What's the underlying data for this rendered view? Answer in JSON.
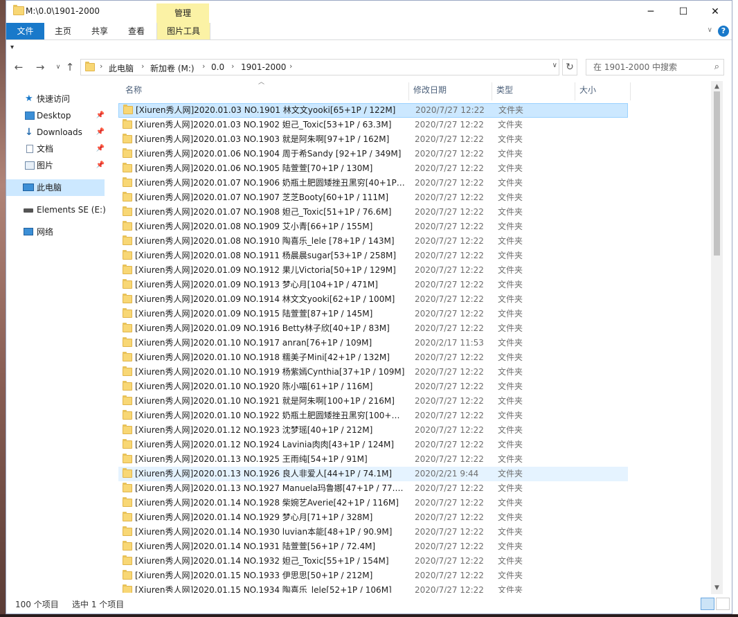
{
  "window": {
    "title": "M:\\0.0\\1901-2000",
    "context_tab": "管理",
    "controls": {
      "minimize": "─",
      "maximize": "☐",
      "close": "✕"
    }
  },
  "ribbon": {
    "tabs": [
      "文件",
      "主页",
      "共享",
      "查看",
      "图片工具"
    ],
    "expand": "∨",
    "help": "?"
  },
  "quick_access": "▾",
  "address": {
    "crumbs": [
      "此电脑",
      "新加卷 (M:)",
      "0.0",
      "1901-2000"
    ],
    "separator": "›",
    "dropdown": "∨",
    "refresh": "↻"
  },
  "search": {
    "placeholder": "在 1901-2000 中搜索",
    "icon": "⌕"
  },
  "sidebar": {
    "items": [
      {
        "label": "快速访问",
        "icon": "star-icon"
      },
      {
        "label": "Desktop",
        "icon": "desktop-icon",
        "pinned": true
      },
      {
        "label": "Downloads",
        "icon": "download-icon",
        "pinned": true
      },
      {
        "label": "文档",
        "icon": "document-icon",
        "pinned": true
      },
      {
        "label": "图片",
        "icon": "pictures-icon",
        "pinned": true
      },
      {
        "label": "此电脑",
        "icon": "computer-icon",
        "selected": true
      },
      {
        "label": "Elements SE (E:)",
        "icon": "drive-icon"
      },
      {
        "label": "网络",
        "icon": "network-icon"
      }
    ],
    "pin_glyph": "📌"
  },
  "columns": {
    "name": "名称",
    "date": "修改日期",
    "type": "类型",
    "size": "大小",
    "sort_glyph": "︿"
  },
  "files": [
    {
      "name": "[Xiuren秀人网]2020.01.03 NO.1901 林文文yooki[65+1P / 122M]",
      "date": "2020/7/27 12:22",
      "type": "文件夹",
      "state": "selected"
    },
    {
      "name": "[Xiuren秀人网]2020.01.03 NO.1902 妲己_Toxic[53+1P / 63.3M]",
      "date": "2020/7/27 12:22",
      "type": "文件夹"
    },
    {
      "name": "[Xiuren秀人网]2020.01.03 NO.1903 就是阿朱啊[97+1P / 162M]",
      "date": "2020/7/27 12:22",
      "type": "文件夹"
    },
    {
      "name": "[Xiuren秀人网]2020.01.06 NO.1904 周于希Sandy [92+1P / 349M]",
      "date": "2020/7/27 12:22",
      "type": "文件夹"
    },
    {
      "name": "[Xiuren秀人网]2020.01.06 NO.1905 陆萱萱[70+1P / 130M]",
      "date": "2020/7/27 12:22",
      "type": "文件夹"
    },
    {
      "name": "[Xiuren秀人网]2020.01.07 NO.1906 奶瓶土肥圆矮挫丑黑穷[40+1P / ...",
      "date": "2020/7/27 12:22",
      "type": "文件夹"
    },
    {
      "name": "[Xiuren秀人网]2020.01.07 NO.1907 芝芝Booty[60+1P / 111M]",
      "date": "2020/7/27 12:22",
      "type": "文件夹"
    },
    {
      "name": "[Xiuren秀人网]2020.01.07 NO.1908 妲己_Toxic[51+1P / 76.6M]",
      "date": "2020/7/27 12:22",
      "type": "文件夹"
    },
    {
      "name": "[Xiuren秀人网]2020.01.08 NO.1909 艾小青[66+1P / 155M]",
      "date": "2020/7/27 12:22",
      "type": "文件夹"
    },
    {
      "name": "[Xiuren秀人网]2020.01.08 NO.1910 陶喜乐_lele [78+1P / 143M]",
      "date": "2020/7/27 12:22",
      "type": "文件夹"
    },
    {
      "name": "[Xiuren秀人网]2020.01.08 NO.1911 杨晨晨sugar[53+1P / 258M]",
      "date": "2020/7/27 12:22",
      "type": "文件夹"
    },
    {
      "name": "[Xiuren秀人网]2020.01.09 NO.1912 果儿Victoria[50+1P / 129M]",
      "date": "2020/7/27 12:22",
      "type": "文件夹"
    },
    {
      "name": "[Xiuren秀人网]2020.01.09 NO.1913 梦心月[104+1P / 471M]",
      "date": "2020/7/27 12:22",
      "type": "文件夹"
    },
    {
      "name": "[Xiuren秀人网]2020.01.09 NO.1914 林文文yooki[62+1P / 100M]",
      "date": "2020/7/27 12:22",
      "type": "文件夹"
    },
    {
      "name": "[Xiuren秀人网]2020.01.09 NO.1915 陆萱萱[87+1P / 145M]",
      "date": "2020/7/27 12:22",
      "type": "文件夹"
    },
    {
      "name": "[Xiuren秀人网]2020.01.09 NO.1916 Betty林子欣[40+1P / 83M]",
      "date": "2020/7/27 12:22",
      "type": "文件夹"
    },
    {
      "name": "[Xiuren秀人网]2020.01.10 NO.1917 anran[76+1P / 109M]",
      "date": "2020/2/17 11:53",
      "type": "文件夹"
    },
    {
      "name": "[Xiuren秀人网]2020.01.10 NO.1918 糯美子Mini[42+1P / 132M]",
      "date": "2020/7/27 12:22",
      "type": "文件夹"
    },
    {
      "name": "[Xiuren秀人网]2020.01.10 NO.1919 杨紫嫣Cynthia[37+1P / 109M]",
      "date": "2020/7/27 12:22",
      "type": "文件夹"
    },
    {
      "name": "[Xiuren秀人网]2020.01.10 NO.1920 陈小喵[61+1P / 116M]",
      "date": "2020/7/27 12:22",
      "type": "文件夹"
    },
    {
      "name": "[Xiuren秀人网]2020.01.10 NO.1921 就是阿朱啊[100+1P / 216M]",
      "date": "2020/7/27 12:22",
      "type": "文件夹"
    },
    {
      "name": "[Xiuren秀人网]2020.01.10 NO.1922 奶瓶土肥圆矮挫丑黑穷[100+1P...",
      "date": "2020/7/27 12:22",
      "type": "文件夹"
    },
    {
      "name": "[Xiuren秀人网]2020.01.12 NO.1923 沈梦瑶[40+1P / 212M]",
      "date": "2020/7/27 12:22",
      "type": "文件夹"
    },
    {
      "name": "[Xiuren秀人网]2020.01.12 NO.1924 Lavinia肉肉[43+1P / 124M]",
      "date": "2020/7/27 12:22",
      "type": "文件夹"
    },
    {
      "name": "[Xiuren秀人网]2020.01.13 NO.1925 王雨纯[54+1P / 91M]",
      "date": "2020/7/27 12:22",
      "type": "文件夹"
    },
    {
      "name": "[Xiuren秀人网]2020.01.13 NO.1926 良人非爱人[44+1P / 74.1M]",
      "date": "2020/2/21 9:44",
      "type": "文件夹",
      "state": "hover"
    },
    {
      "name": "[Xiuren秀人网]2020.01.13 NO.1927 Manuela玛鲁娜[47+1P / 77.6M]",
      "date": "2020/7/27 12:22",
      "type": "文件夹"
    },
    {
      "name": "[Xiuren秀人网]2020.01.14 NO.1928 柴婉艺Averie[42+1P / 116M]",
      "date": "2020/7/27 12:22",
      "type": "文件夹"
    },
    {
      "name": "[Xiuren秀人网]2020.01.14 NO.1929 梦心月[71+1P / 328M]",
      "date": "2020/7/27 12:22",
      "type": "文件夹"
    },
    {
      "name": "[Xiuren秀人网]2020.01.14 NO.1930 luvian本能[48+1P / 90.9M]",
      "date": "2020/7/27 12:22",
      "type": "文件夹"
    },
    {
      "name": "[Xiuren秀人网]2020.01.14 NO.1931 陆萱萱[56+1P / 72.4M]",
      "date": "2020/7/27 12:22",
      "type": "文件夹"
    },
    {
      "name": "[Xiuren秀人网]2020.01.14 NO.1932 妲己_Toxic[55+1P / 154M]",
      "date": "2020/7/27 12:22",
      "type": "文件夹"
    },
    {
      "name": "[Xiuren秀人网]2020.01.15 NO.1933 伊思思[50+1P / 212M]",
      "date": "2020/7/27 12:22",
      "type": "文件夹"
    },
    {
      "name": "[Xiuren秀人网]2020.01.15 NO.1934 陶喜乐_lele[52+1P / 106M]",
      "date": "2020/7/27 12:22",
      "type": "文件夹"
    }
  ],
  "status": {
    "count": "100 个项目",
    "selected": "选中 1 个项目"
  },
  "scrollbar": {
    "up": "▲",
    "down": "▼"
  },
  "colors": {
    "accent": "#1979ca",
    "selection": "#cce8ff",
    "context_tab": "#fbf2a5"
  }
}
